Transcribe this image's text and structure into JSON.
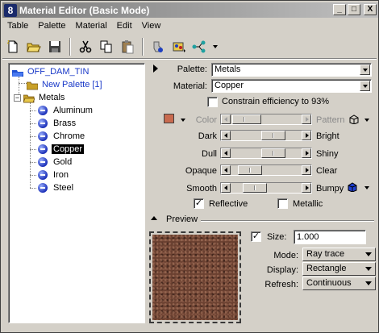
{
  "window": {
    "title": "Material Editor (Basic Mode)",
    "icon_letter": "8",
    "controls": {
      "minimize": "_",
      "maximize": "□",
      "close": "X"
    }
  },
  "menu": [
    "Table",
    "Palette",
    "Material",
    "Edit",
    "View"
  ],
  "toolbar": [
    "new-icon",
    "open-icon",
    "save-icon",
    "cut-icon",
    "copy-icon",
    "paste-icon",
    "assign-icon",
    "palette-icon",
    "tree-icon"
  ],
  "tree": {
    "root": "OFF_DAM_TIN",
    "new_palette": "New Palette [1]",
    "palette": "Metals",
    "materials": [
      "Aluminum",
      "Brass",
      "Chrome",
      "Copper",
      "Gold",
      "Iron",
      "Steel"
    ],
    "selected": "Copper"
  },
  "settings": {
    "palette_label": "Palette:",
    "palette_value": "Metals",
    "material_label": "Material:",
    "material_value": "Copper",
    "constrain_label": "Constrain efficiency to 93%",
    "constrain_checked": false
  },
  "swatch_color": "#c86a4f",
  "properties": {
    "color_label": "Color",
    "pattern_label": "Pattern",
    "dark": "Dark",
    "bright": "Bright",
    "dull": "Dull",
    "shiny": "Shiny",
    "opaque": "Opaque",
    "clear": "Clear",
    "smooth": "Smooth",
    "bumpy": "Bumpy",
    "reflective_label": "Reflective",
    "reflective_checked": true,
    "metallic_label": "Metallic",
    "metallic_checked": false
  },
  "sliders": {
    "dark_bright": 0.65,
    "dull_shiny": 0.65,
    "opaque_clear": 0.15,
    "smooth_bumpy": 0.25
  },
  "preview": {
    "header": "Preview",
    "size_label": "Size:",
    "size_checked": true,
    "size_value": "1.000",
    "mode_label": "Mode:",
    "mode_value": "Ray trace",
    "display_label": "Display:",
    "display_value": "Rectangle",
    "refresh_label": "Refresh:",
    "refresh_value": "Continuous"
  }
}
